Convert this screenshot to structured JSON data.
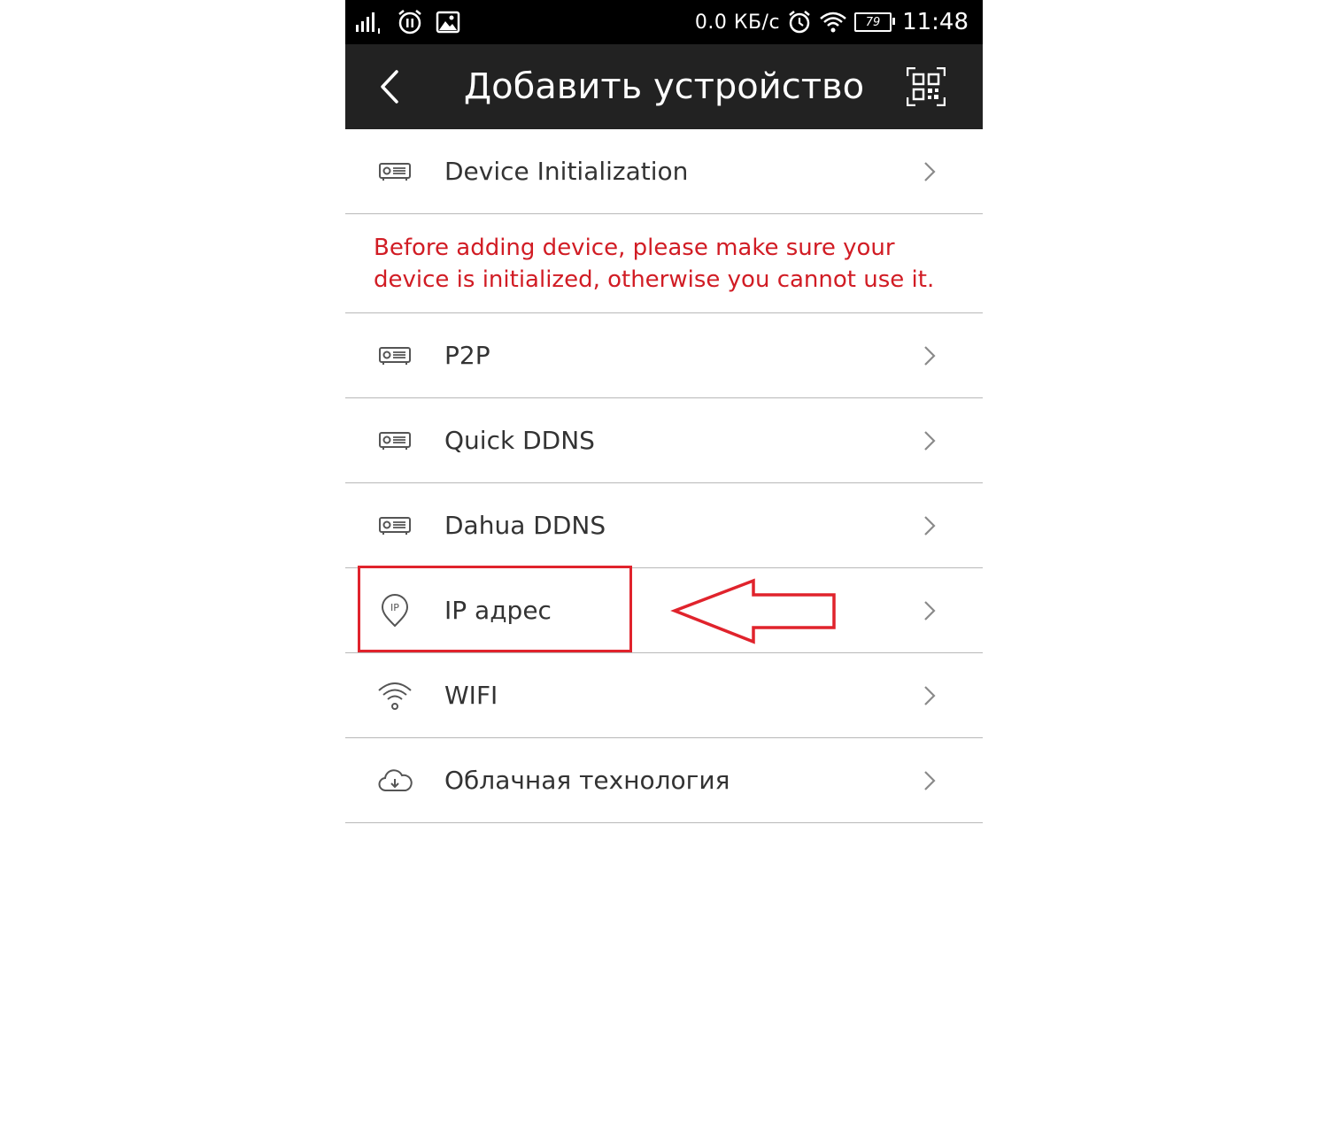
{
  "status_bar": {
    "speed": "0.0 КБ/с",
    "battery": "79",
    "time": "11:48"
  },
  "header": {
    "title": "Добавить устройство"
  },
  "items": [
    {
      "label": "Device Initialization",
      "icon": "device-icon"
    },
    {
      "label": "P2P",
      "icon": "device-icon"
    },
    {
      "label": "Quick DDNS",
      "icon": "device-icon"
    },
    {
      "label": "Dahua DDNS",
      "icon": "device-icon"
    },
    {
      "label": "IP адрес",
      "icon": "ip-pin-icon"
    },
    {
      "label": "WIFI",
      "icon": "wifi-icon"
    },
    {
      "label": "Облачная технология",
      "icon": "cloud-icon"
    }
  ],
  "notice": {
    "text": "Before adding device, please make sure your device is initialized, otherwise you cannot use it."
  },
  "colors": {
    "header_bg": "#222222",
    "notice_text": "#d11c24",
    "annotation": "#e0232c"
  }
}
